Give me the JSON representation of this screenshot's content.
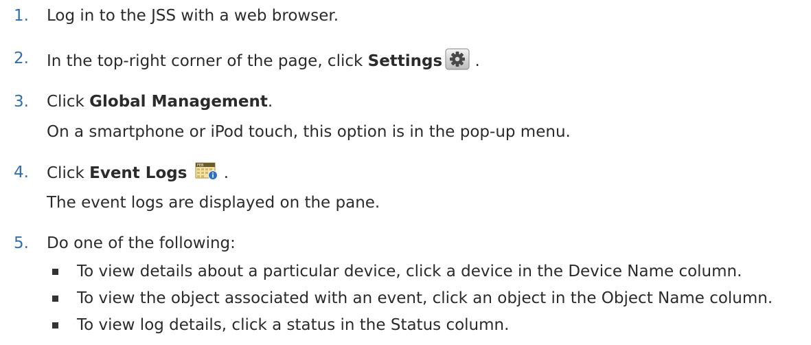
{
  "steps": [
    {
      "num": "1.",
      "text": "Log in to the JSS with a web browser."
    },
    {
      "num": "2.",
      "pre": "In the top-right corner of the page, click ",
      "bold": "Settings",
      "post": " ."
    },
    {
      "num": "3.",
      "pre": "Click ",
      "bold": "Global Management",
      "post": ".",
      "note": "On a smartphone or iPod touch, this option is in the pop-up menu."
    },
    {
      "num": "4.",
      "pre": "Click ",
      "bold": "Event Logs",
      "post": " .",
      "note": "The event logs are displayed on the pane."
    },
    {
      "num": "5.",
      "text": "Do one of the following:"
    }
  ],
  "bullets": [
    "To view details about a particular device, click a device in the Device Name column.",
    "To view the object associated with an event, click an object in the Object Name column.",
    "To view log details, click a status in the Status column."
  ],
  "icons": {
    "settings": "gear-icon",
    "event_logs": "calendar-info-icon",
    "calendar_month": "FEB"
  },
  "colors": {
    "step_number": "#2f6fb0",
    "text": "#2b2b2b"
  }
}
